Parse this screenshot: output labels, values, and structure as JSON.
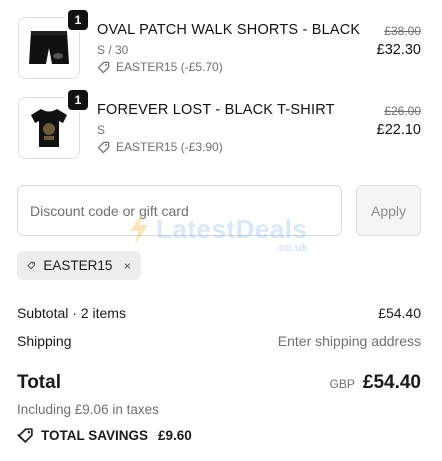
{
  "items": [
    {
      "quantity": "1",
      "name": "OVAL PATCH WALK SHORTS - BLACK",
      "variant": "S / 30",
      "discount": "EASTER15 (-£5.70)",
      "original_price": "£38.00",
      "price": "£32.30"
    },
    {
      "quantity": "1",
      "name": "FOREVER LOST - BLACK T-SHIRT",
      "variant": "S",
      "discount": "EASTER15 (-£3.90)",
      "original_price": "£26.00",
      "price": "£22.10"
    }
  ],
  "discount_form": {
    "placeholder": "Discount code or gift card",
    "apply_label": "Apply",
    "applied_code": "EASTER15"
  },
  "summary": {
    "subtotal_label": "Subtotal · 2 items",
    "subtotal_value": "£54.40",
    "shipping_label": "Shipping",
    "shipping_value": "Enter shipping address",
    "total_label": "Total",
    "currency": "GBP",
    "total_value": "£54.40",
    "taxes_note": "Including £9.06 in taxes",
    "savings_label": "TOTAL SAVINGS",
    "savings_value": "£9.60"
  },
  "watermark": {
    "text": "LatestDeals",
    "subtext": ".co.uk"
  },
  "icons": [
    "tag-icon",
    "close-icon",
    "shorts-image",
    "tshirt-image"
  ],
  "colors": {
    "text": "#1a1a1a",
    "muted": "#707070",
    "badge": "#111111",
    "chip": "#ededed"
  }
}
